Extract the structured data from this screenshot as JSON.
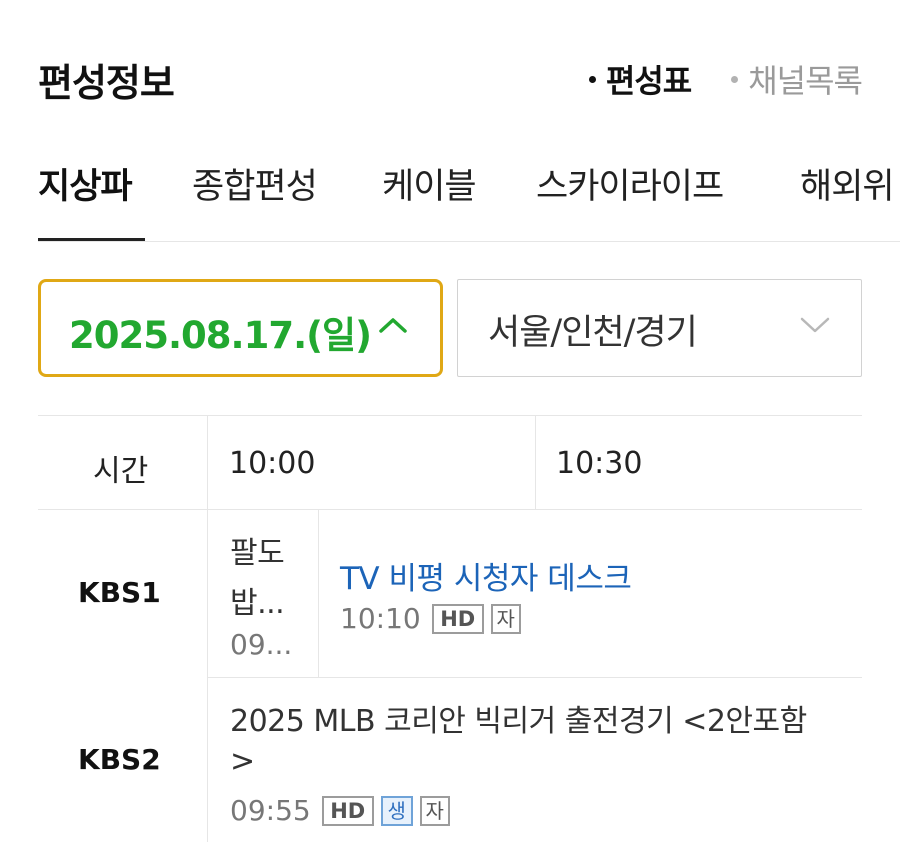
{
  "header": {
    "title": "편성정보",
    "links": [
      {
        "label": "편성표",
        "active": true
      },
      {
        "label": "채널목록",
        "active": false
      }
    ]
  },
  "tabs": [
    {
      "label": "지상파",
      "active": true
    },
    {
      "label": "종합편성",
      "active": false
    },
    {
      "label": "케이블",
      "active": false
    },
    {
      "label": "스카이라이프",
      "active": false
    },
    {
      "label": "해외위",
      "active": false
    }
  ],
  "filters": {
    "date": "2025.08.17.(일)",
    "region": "서울/인천/경기"
  },
  "schedule": {
    "time_header": "시간",
    "time_slots": [
      "10:00",
      "10:30"
    ],
    "rows": [
      {
        "channel": "KBS1",
        "programs": [
          {
            "title_line1": "팔도",
            "title_line2": "밥...",
            "time": "09..."
          },
          {
            "title": "TV 비평 시청자 데스크",
            "time": "10:10",
            "badges": [
              "HD",
              "자"
            ]
          }
        ]
      },
      {
        "channel": "KBS2",
        "programs": [
          {
            "title_line1": "2025 MLB 코리안 빅리거 출전경기 <2안포함",
            "title_line2": ">",
            "time": "09:55",
            "badges": [
              "HD",
              "생",
              "자"
            ]
          }
        ]
      }
    ]
  },
  "colors": {
    "accent_green": "#22a830",
    "accent_border": "#e0a815",
    "link_blue": "#1c64b8"
  }
}
